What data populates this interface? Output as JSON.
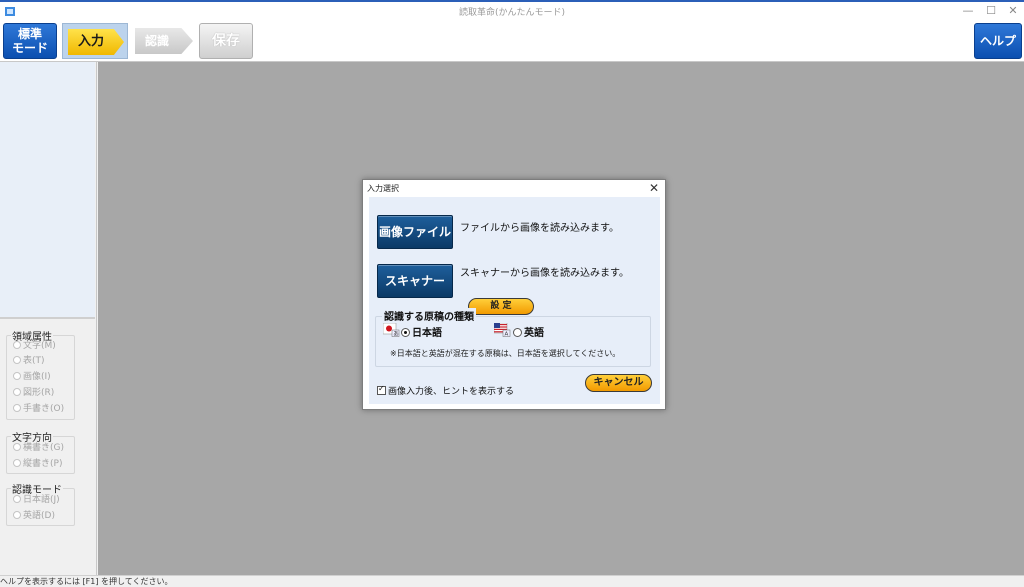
{
  "window": {
    "title": "読取革命(かんたんモード)",
    "minimize_glyph": "—",
    "maximize_glyph": "☐",
    "close_glyph": "✕"
  },
  "toolbar": {
    "mode_line1": "標準",
    "mode_line2": "モード",
    "step_input": "入力",
    "step_recognize": "認識",
    "save": "保存",
    "help": "ヘルプ"
  },
  "sidebar": {
    "region_attr": {
      "title": "領域属性",
      "items": [
        "文字(M)",
        "表(T)",
        "画像(I)",
        "図形(R)",
        "手書き(O)"
      ]
    },
    "text_direction": {
      "title": "文字方向",
      "items": [
        "横書き(G)",
        "縦書き(P)"
      ]
    },
    "recog_mode": {
      "title": "認識モード",
      "items": [
        "日本語(J)",
        "英語(D)"
      ]
    }
  },
  "status": {
    "text": "ヘルプを表示するには [F1] を押してください。"
  },
  "dialog": {
    "title": "入力選択",
    "close_glyph": "✕",
    "image_file_button": "画像ファイル",
    "image_file_desc": "ファイルから画像を読み込みます。",
    "scanner_button": "スキャナー",
    "scanner_desc": "スキャナーから画像を読み込みます。",
    "settings_button": "設 定",
    "doc_type": {
      "title": "認識する原稿の種類",
      "japanese": "日本語",
      "english": "英語",
      "selected": "日本語",
      "note": "※日本語と英語が混在する原稿は、日本語を選択してください。"
    },
    "show_hint": "画像入力後、ヒントを表示する",
    "show_hint_checked": true,
    "cancel_button": "キャンセル"
  },
  "colors": {
    "accent_blue": "#0b4fb0",
    "step_yellow": "#f0b800",
    "button_orange": "#f29a00",
    "dialog_navy": "#0b3966",
    "workspace_gray": "#a7a7a7"
  }
}
